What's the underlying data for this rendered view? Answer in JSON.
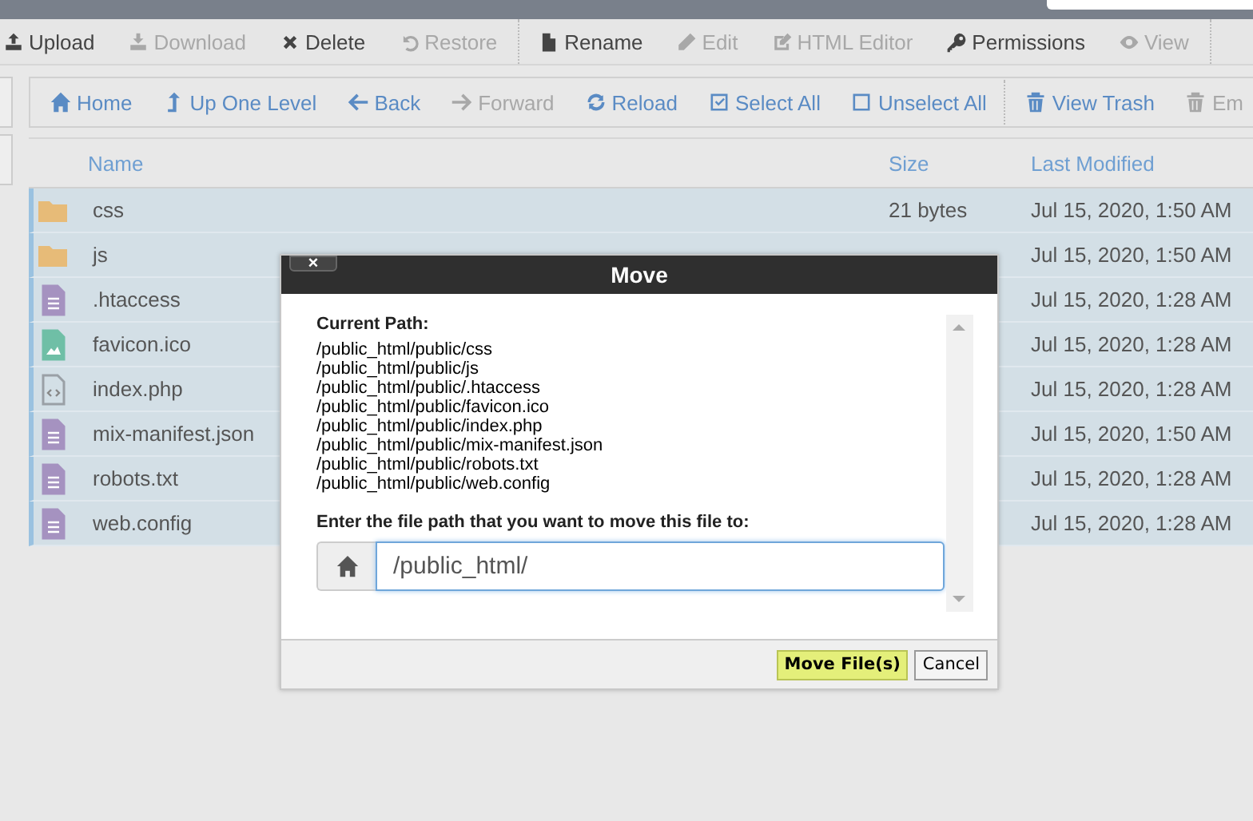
{
  "toolbar": [
    {
      "label": "Upload",
      "disabled": false
    },
    {
      "label": "Download",
      "disabled": true
    },
    {
      "label": "Delete",
      "disabled": false
    },
    {
      "label": "Restore",
      "disabled": true
    },
    {
      "label": "Rename",
      "disabled": false
    },
    {
      "label": "Edit",
      "disabled": true
    },
    {
      "label": "HTML Editor",
      "disabled": true
    },
    {
      "label": "Permissions",
      "disabled": false
    },
    {
      "label": "View",
      "disabled": true
    }
  ],
  "navbar": [
    {
      "label": "Home",
      "disabled": false
    },
    {
      "label": "Up One Level",
      "disabled": false
    },
    {
      "label": "Back",
      "disabled": false
    },
    {
      "label": "Forward",
      "disabled": true
    },
    {
      "label": "Reload",
      "disabled": false
    },
    {
      "label": "Select All",
      "disabled": false
    },
    {
      "label": "Unselect All",
      "disabled": false
    },
    {
      "label": "View Trash",
      "disabled": false
    },
    {
      "label": "Em",
      "disabled": true
    }
  ],
  "table": {
    "columns": [
      "Name",
      "Size",
      "Last Modified"
    ],
    "rows": [
      {
        "kind": "folder",
        "name": "css",
        "size": "21 bytes",
        "modified": "Jul 15, 2020, 1:50 AM",
        "selected": true
      },
      {
        "kind": "folder",
        "name": "js",
        "modified": "Jul 15, 2020, 1:50 AM",
        "selected": true
      },
      {
        "kind": "file",
        "name": ".htaccess",
        "modified": "Jul 15, 2020, 1:28 AM",
        "selected": true
      },
      {
        "kind": "image",
        "name": "favicon.ico",
        "modified": "Jul 15, 2020, 1:28 AM",
        "selected": true
      },
      {
        "kind": "code",
        "name": "index.php",
        "modified": "Jul 15, 2020, 1:28 AM",
        "selected": true
      },
      {
        "kind": "file",
        "name": "mix-manifest.json",
        "modified": "Jul 15, 2020, 1:50 AM",
        "selected": true
      },
      {
        "kind": "file",
        "name": "robots.txt",
        "modified": "Jul 15, 2020, 1:28 AM",
        "selected": true
      },
      {
        "kind": "file",
        "name": "web.config",
        "modified": "Jul 15, 2020, 1:28 AM",
        "selected": true
      }
    ]
  },
  "dialog": {
    "close": "×",
    "title": "Move",
    "current_path_label": "Current Path:",
    "paths": [
      "/public_html/public/css",
      "/public_html/public/js",
      "/public_html/public/.htaccess",
      "/public_html/public/favicon.ico",
      "/public_html/public/index.php",
      "/public_html/public/mix-manifest.json",
      "/public_html/public/robots.txt",
      "/public_html/public/web.config"
    ],
    "prompt": "Enter the file path that you want to move this file to:",
    "destination": "/public_html/",
    "buttons": [
      {
        "label": "Move File(s)",
        "kind": "primary"
      },
      {
        "label": "Cancel",
        "kind": "secondary"
      }
    ]
  }
}
